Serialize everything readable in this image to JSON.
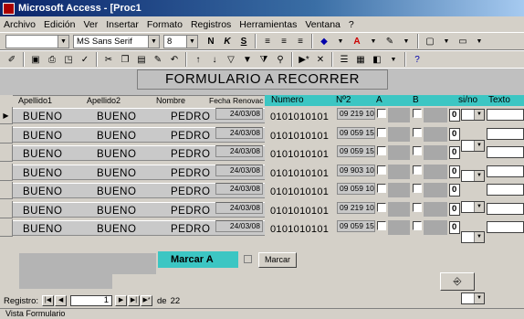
{
  "window": {
    "title": "Microsoft Access - [Proc1"
  },
  "menu": [
    "Archivo",
    "Edición",
    "Ver",
    "Insertar",
    "Formato",
    "Registros",
    "Herramientas",
    "Ventana",
    "?"
  ],
  "toolbar1": {
    "font": "MS Sans Serif",
    "size": "8",
    "bold": "N",
    "italic": "K",
    "underline": "S"
  },
  "form": {
    "title": "FORMULARIO A RECORRER",
    "columns": {
      "apellido1": "Apellido1",
      "apellido2": "Apellido2",
      "nombre": "Nombre",
      "fecha": "Fecha Renovac",
      "numero": "Numero",
      "n2": "Nº2",
      "a": "A",
      "b": "B",
      "sino": "si/no",
      "texto": "Texto"
    },
    "rows": [
      {
        "apellido1": "BUENO",
        "apellido2": "BUENO",
        "nombre": "PEDRO",
        "fecha": "24/03/08",
        "numero": "0101010101",
        "n2": "09 219 10",
        "num": "0"
      },
      {
        "apellido1": "BUENO",
        "apellido2": "BUENO",
        "nombre": "PEDRO",
        "fecha": "24/03/08",
        "numero": "0101010101",
        "n2": "09 059 15",
        "num": "0"
      },
      {
        "apellido1": "BUENO",
        "apellido2": "BUENO",
        "nombre": "PEDRO",
        "fecha": "24/03/08",
        "numero": "0101010101",
        "n2": "09 059 15",
        "num": "0"
      },
      {
        "apellido1": "BUENO",
        "apellido2": "BUENO",
        "nombre": "PEDRO",
        "fecha": "24/03/08",
        "numero": "0101010101",
        "n2": "09 903 10",
        "num": "0"
      },
      {
        "apellido1": "BUENO",
        "apellido2": "BUENO",
        "nombre": "PEDRO",
        "fecha": "24/03/08",
        "numero": "0101010101",
        "n2": "09 059 10",
        "num": "0"
      },
      {
        "apellido1": "BUENO",
        "apellido2": "BUENO",
        "nombre": "PEDRO",
        "fecha": "24/03/08",
        "numero": "0101010101",
        "n2": "09 219 10",
        "num": "0"
      },
      {
        "apellido1": "BUENO",
        "apellido2": "BUENO",
        "nombre": "PEDRO",
        "fecha": "24/03/08",
        "numero": "0101010101",
        "n2": "09 059 15",
        "num": "0"
      }
    ],
    "footer": {
      "marcar_label": "Marcar   A",
      "marcar_button": "Marcar"
    }
  },
  "navigation": {
    "label": "Registro:",
    "current": "1",
    "of": "de",
    "total": "22"
  },
  "status": {
    "text": "Vista Formulario"
  },
  "colors": {
    "accent": "#3cc6c3",
    "title_bar": "#0a246a"
  }
}
